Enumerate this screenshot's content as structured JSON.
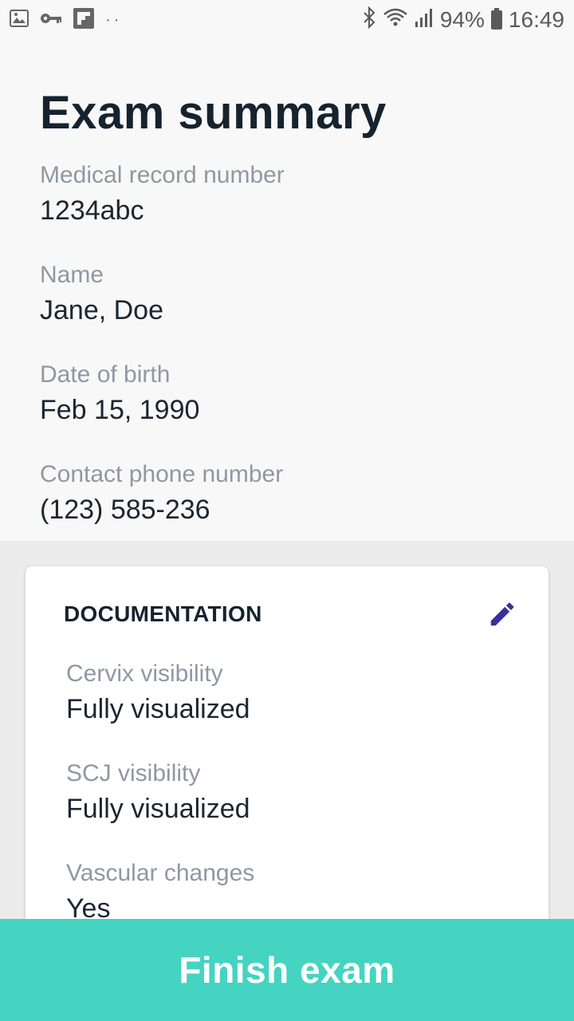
{
  "status_bar": {
    "battery": "94%",
    "time": "16:49",
    "left_icons": [
      "image-icon",
      "key-icon",
      "flipboard-icon",
      "more-dots-icon"
    ],
    "right_icons": [
      "bluetooth-icon",
      "wifi-icon",
      "signal-icon",
      "battery-icon"
    ]
  },
  "header": {
    "title": "Exam summary",
    "fields": [
      {
        "label": "Medical record number",
        "value": "1234abc"
      },
      {
        "label": "Name",
        "value": "Jane, Doe"
      },
      {
        "label": "Date of birth",
        "value": "Feb 15, 1990"
      },
      {
        "label": "Contact phone number",
        "value": "(123) 585-236"
      }
    ]
  },
  "documentation": {
    "title": "DOCUMENTATION",
    "edit_icon": "pencil-icon",
    "items": [
      {
        "label": "Cervix visibility",
        "value": "Fully visualized"
      },
      {
        "label": "SCJ visibility",
        "value": "Fully visualized"
      },
      {
        "label": "Vascular changes",
        "value": "Yes"
      }
    ]
  },
  "footer": {
    "finish_label": "Finish exam"
  },
  "colors": {
    "accent": "#44d4c1",
    "edit_icon": "#3b2fa0",
    "title": "#16232e",
    "label": "#8f98a3"
  }
}
